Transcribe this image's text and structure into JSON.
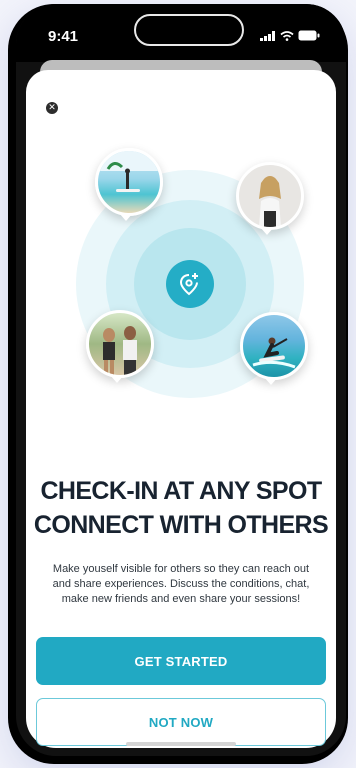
{
  "status": {
    "time": "9:41"
  },
  "headline": {
    "line1": "CHECK-IN AT ANY SPOT",
    "line2": "CONNECT WITH OTHERS"
  },
  "body": "Make youself visible for others so they can reach out and share experiences. Discuss the conditions, chat, make new friends and even share your sessions!",
  "buttons": {
    "primary": "GET STARTED",
    "secondary": "NOT NOW"
  },
  "colors": {
    "accent": "#21a9c3",
    "text": "#182330"
  },
  "icons": {
    "close": "close-icon",
    "center": "location-pin-plus-icon"
  },
  "avatars": [
    "surf-spot-avatar",
    "woman-avatar",
    "group-avatar",
    "kitesurfer-avatar"
  ]
}
